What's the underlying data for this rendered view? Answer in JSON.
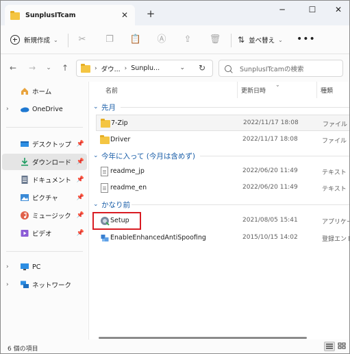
{
  "window": {
    "tab_title": "SunplusITcam",
    "tab_close": "✕",
    "new_tab": "+",
    "minimize": "─",
    "maximize": "☐",
    "close": "✕"
  },
  "toolbar": {
    "new_label": "新規作成",
    "sort_label": "並べ替え",
    "more_label": "•••",
    "icons": [
      "cut-icon",
      "copy-icon",
      "paste-icon",
      "rename-icon",
      "share-icon",
      "delete-icon"
    ]
  },
  "address": {
    "crumbs": [
      "ダウ...",
      "Sunplu..."
    ],
    "search_placeholder": "SunplusITcamの検索"
  },
  "nav": {
    "items": [
      {
        "label": "ホーム",
        "icon": "home-icon"
      },
      {
        "label": "OneDrive",
        "icon": "onedrive-icon"
      },
      {
        "label": "デスクトップ",
        "icon": "desktop-icon"
      },
      {
        "label": "ダウンロード",
        "icon": "download-icon"
      },
      {
        "label": "ドキュメント",
        "icon": "documents-icon"
      },
      {
        "label": "ピクチャ",
        "icon": "pictures-icon"
      },
      {
        "label": "ミュージック",
        "icon": "music-icon"
      },
      {
        "label": "ビデオ",
        "icon": "videos-icon"
      },
      {
        "label": "PC",
        "icon": "pc-icon"
      },
      {
        "label": "ネットワーク",
        "icon": "network-icon"
      }
    ]
  },
  "columns": {
    "name": "名前",
    "date": "更新日時",
    "type": "種類"
  },
  "groups": [
    {
      "label": "先月",
      "rows": [
        {
          "name": "7-Zip",
          "date": "2022/11/17 18:08",
          "type": "ファイル フ"
        },
        {
          "name": "Driver",
          "date": "2022/11/17 18:08",
          "type": "ファイル フ"
        }
      ]
    },
    {
      "label": "今年に入って (今月は含めず)",
      "rows": [
        {
          "name": "readme_jp",
          "date": "2022/06/20 11:49",
          "type": "テキスト ド"
        },
        {
          "name": "readme_en",
          "date": "2022/06/20 11:49",
          "type": "テキスト ド"
        }
      ]
    },
    {
      "label": "かなり前",
      "rows": [
        {
          "name": "Setup",
          "date": "2021/08/05 15:41",
          "type": "アプリケーシ"
        },
        {
          "name": "EnableEnhancedAntiSpoofing",
          "date": "2015/10/15 14:02",
          "type": "登録エントリ"
        }
      ]
    }
  ],
  "status": {
    "item_count": "6 個の項目"
  }
}
